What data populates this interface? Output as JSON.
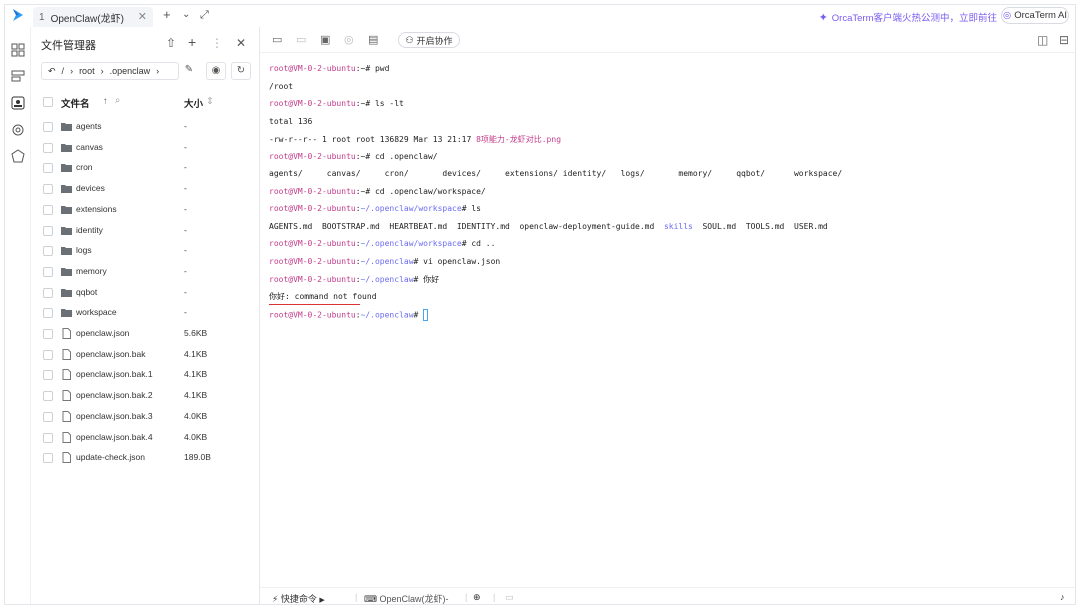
{
  "tab": {
    "number": "1",
    "title": "OpenClaw(龙虾)"
  },
  "promo": {
    "text": "OrcaTerm客户端火热公测中，立即前往"
  },
  "ai_button": {
    "label": "OrcaTerm AI"
  },
  "file_manager": {
    "title": "文件管理器",
    "path": [
      "/",
      "root",
      ".openclaw"
    ],
    "columns": {
      "name": "文件名",
      "size": "大小"
    },
    "rows": [
      {
        "name": "agents",
        "size": "-",
        "type": "folder"
      },
      {
        "name": "canvas",
        "size": "-",
        "type": "folder"
      },
      {
        "name": "cron",
        "size": "-",
        "type": "folder"
      },
      {
        "name": "devices",
        "size": "-",
        "type": "folder"
      },
      {
        "name": "extensions",
        "size": "-",
        "type": "folder"
      },
      {
        "name": "identity",
        "size": "-",
        "type": "folder"
      },
      {
        "name": "logs",
        "size": "-",
        "type": "folder"
      },
      {
        "name": "memory",
        "size": "-",
        "type": "folder"
      },
      {
        "name": "qqbot",
        "size": "-",
        "type": "folder"
      },
      {
        "name": "workspace",
        "size": "-",
        "type": "folder"
      },
      {
        "name": "openclaw.json",
        "size": "5.6KB",
        "type": "file"
      },
      {
        "name": "openclaw.json.bak",
        "size": "4.1KB",
        "type": "file"
      },
      {
        "name": "openclaw.json.bak.1",
        "size": "4.1KB",
        "type": "file"
      },
      {
        "name": "openclaw.json.bak.2",
        "size": "4.1KB",
        "type": "file"
      },
      {
        "name": "openclaw.json.bak.3",
        "size": "4.0KB",
        "type": "file"
      },
      {
        "name": "openclaw.json.bak.4",
        "size": "4.0KB",
        "type": "file"
      },
      {
        "name": "update-check.json",
        "size": "189.0B",
        "type": "file"
      }
    ]
  },
  "terminal": {
    "collab_label": "开启协作",
    "lines": [
      [
        {
          "t": "root@VM-0-2-ubuntu",
          "c": "pr"
        },
        {
          "t": ":~# pwd",
          "c": ""
        }
      ],
      [
        {
          "t": "/root",
          "c": ""
        }
      ],
      [
        {
          "t": "root@VM-0-2-ubuntu",
          "c": "pr"
        },
        {
          "t": ":~# ls -lt",
          "c": ""
        }
      ],
      [
        {
          "t": "total 136",
          "c": ""
        }
      ],
      [
        {
          "t": "-rw-r--r-- 1 root root 136829 Mar 13 21:17 ",
          "c": ""
        },
        {
          "t": "8项能力-龙虾对比.png",
          "c": "pr"
        }
      ],
      [
        {
          "t": "root@VM-0-2-ubuntu",
          "c": "pr"
        },
        {
          "t": ":~# cd .openclaw/",
          "c": ""
        }
      ],
      [
        {
          "t": "agents/     canvas/     cron/       devices/     extensions/ identity/   logs/       memory/     qqbot/      workspace/",
          "c": ""
        }
      ],
      [
        {
          "t": "root@VM-0-2-ubuntu",
          "c": "pr"
        },
        {
          "t": ":~# cd .openclaw/workspace/",
          "c": ""
        }
      ],
      [
        {
          "t": "root@VM-0-2-ubuntu",
          "c": "pr"
        },
        {
          "t": ":",
          "c": ""
        },
        {
          "t": "~/.openclaw/workspace",
          "c": "pp"
        },
        {
          "t": "# ls",
          "c": ""
        }
      ],
      [
        {
          "t": "AGENTS.md  BOOTSTRAP.md  HEARTBEAT.md  IDENTITY.md  openclaw-deployment-guide.md  ",
          "c": ""
        },
        {
          "t": "skills",
          "c": "pp"
        },
        {
          "t": "  SOUL.md  TOOLS.md  USER.md",
          "c": ""
        }
      ],
      [
        {
          "t": "root@VM-0-2-ubuntu",
          "c": "pr"
        },
        {
          "t": ":",
          "c": ""
        },
        {
          "t": "~/.openclaw/workspace",
          "c": "pp"
        },
        {
          "t": "# cd ..",
          "c": ""
        }
      ],
      [
        {
          "t": "root@VM-0-2-ubuntu",
          "c": "pr"
        },
        {
          "t": ":",
          "c": ""
        },
        {
          "t": "~/.openclaw",
          "c": "pp"
        },
        {
          "t": "# vi openclaw.json",
          "c": ""
        }
      ],
      [
        {
          "t": "root@VM-0-2-ubuntu",
          "c": "pr"
        },
        {
          "t": ":",
          "c": ""
        },
        {
          "t": "~/.openclaw",
          "c": "pp"
        },
        {
          "t": "# 你好",
          "c": ""
        }
      ],
      [
        {
          "t": "你好: command not found",
          "c": ""
        }
      ],
      [
        {
          "t": "root@VM-0-2-ubuntu",
          "c": "pr"
        },
        {
          "t": ":",
          "c": ""
        },
        {
          "t": "~/.openclaw",
          "c": "pp"
        },
        {
          "t": "# ",
          "c": ""
        }
      ]
    ]
  },
  "statusbar": {
    "quick_cmd": "快捷命令",
    "session": "OpenClaw(龙虾)-"
  }
}
